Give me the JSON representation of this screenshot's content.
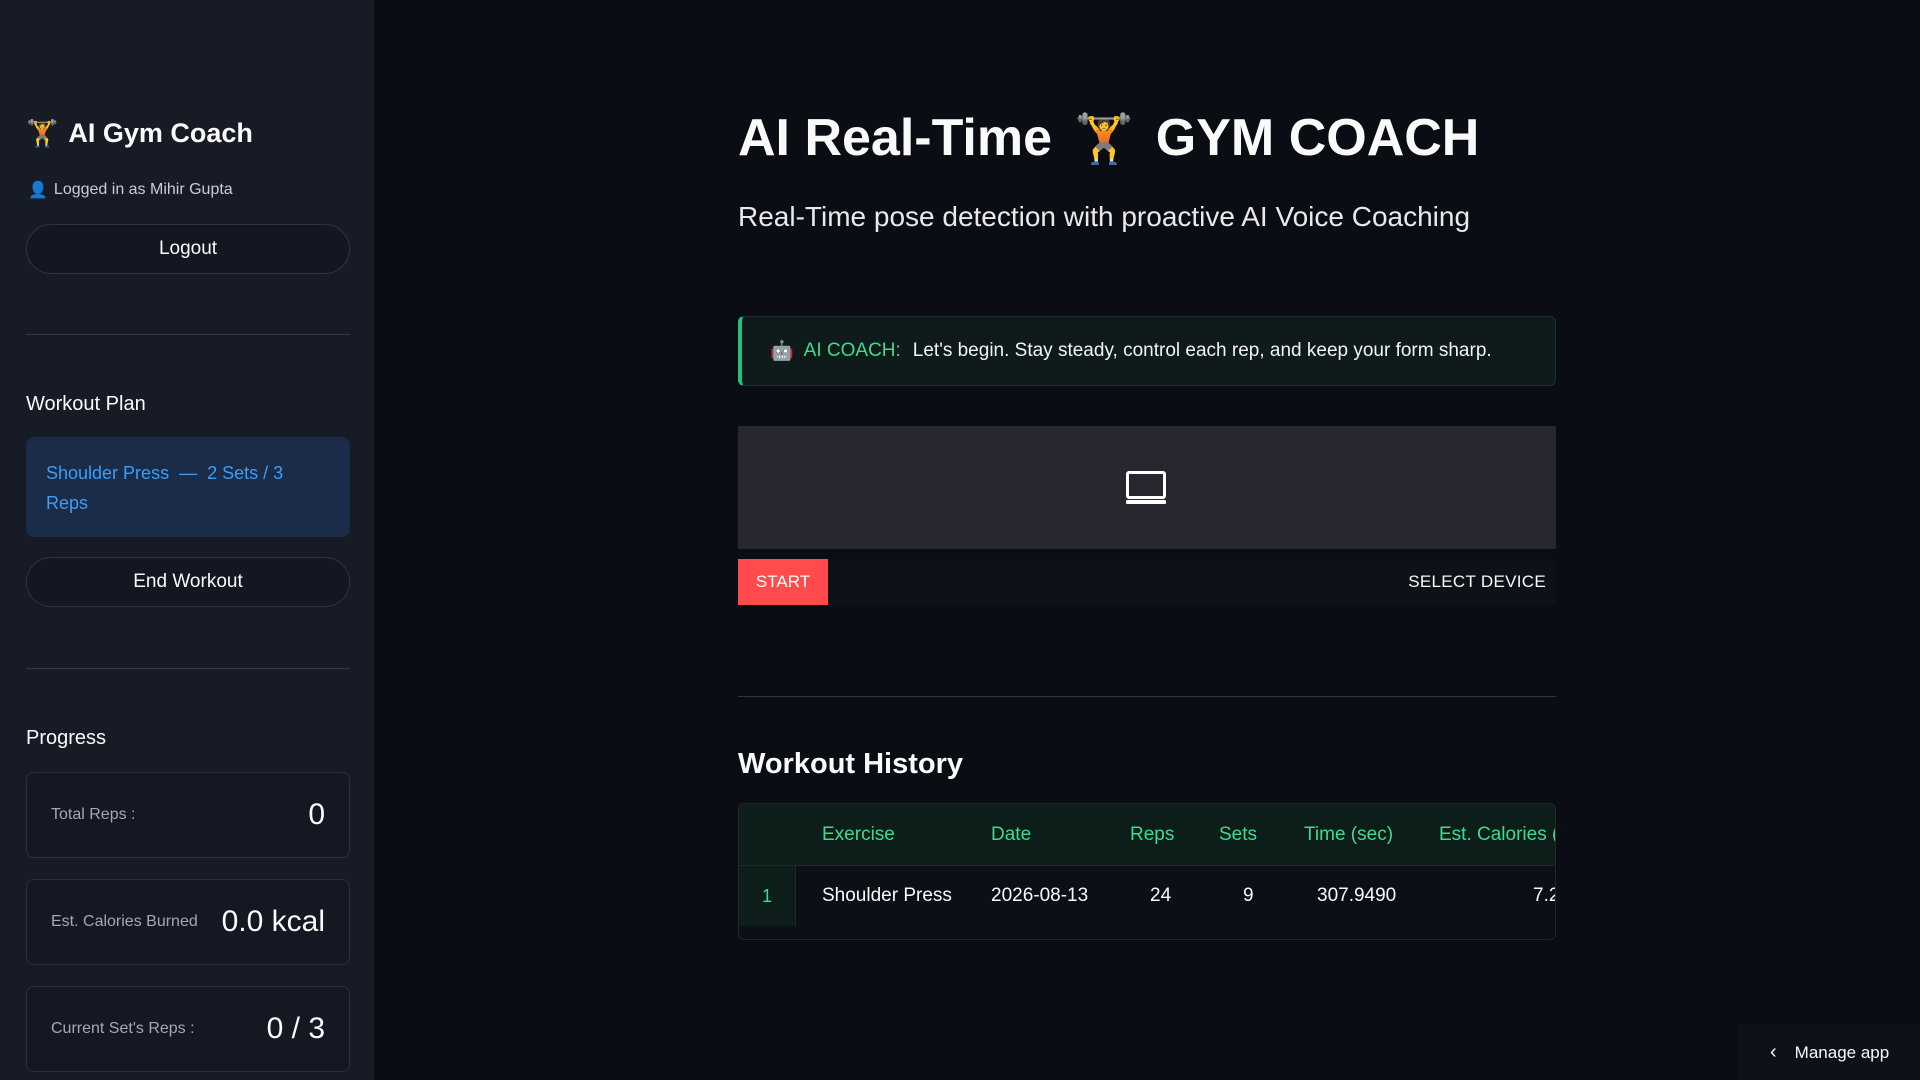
{
  "sidebar": {
    "brand_emoji": "🏋️",
    "brand_title": "AI Gym Coach",
    "user_emoji": "👤",
    "logged_in_text": "Logged in as Mihir Gupta",
    "logout_label": "Logout",
    "workout_plan_title": "Workout Plan",
    "plan": {
      "exercise": "Shoulder Press",
      "separator": "—",
      "detail_line1": "2 Sets / 3",
      "detail_line2": "Reps"
    },
    "end_workout_label": "End Workout",
    "progress_title": "Progress",
    "metrics": [
      {
        "label": "Total Reps :",
        "value": "0"
      },
      {
        "label": "Est. Calories Burned",
        "value": "0.0 kcal"
      },
      {
        "label": "Current Set's Reps :",
        "value": "0 / 3"
      }
    ]
  },
  "main": {
    "title_left": "AI Real-Time",
    "title_emoji": "🏋️",
    "title_right": "GYM COACH",
    "subtitle": "Real-Time pose detection with proactive AI Voice Coaching",
    "coach": {
      "emoji": "🤖",
      "label": "AI COACH:",
      "message": "Let's begin. Stay steady, control each rep, and keep your form sharp."
    },
    "video": {
      "icon": "monitor-icon"
    },
    "start_label": "START",
    "select_device_label": "SELECT DEVICE",
    "history_title": "Workout History",
    "history_table": {
      "columns": [
        "Exercise",
        "Date",
        "Reps",
        "Sets",
        "Time (sec)",
        "Est. Calories (k"
      ],
      "rows": [
        {
          "index": "1",
          "exercise": "Shoulder Press",
          "date": "2026-08-13",
          "reps": "24",
          "sets": "9",
          "time": "307.9490",
          "calories": "7.2"
        }
      ]
    }
  },
  "footer": {
    "manage_app_label": "Manage app",
    "chevron": "‹"
  },
  "colors": {
    "accent_green": "#3ddc8c",
    "start_red": "#ff4b4b",
    "plan_blue": "#3d9df6",
    "sidebar_bg": "#171b26",
    "main_bg": "#0b0d14"
  }
}
